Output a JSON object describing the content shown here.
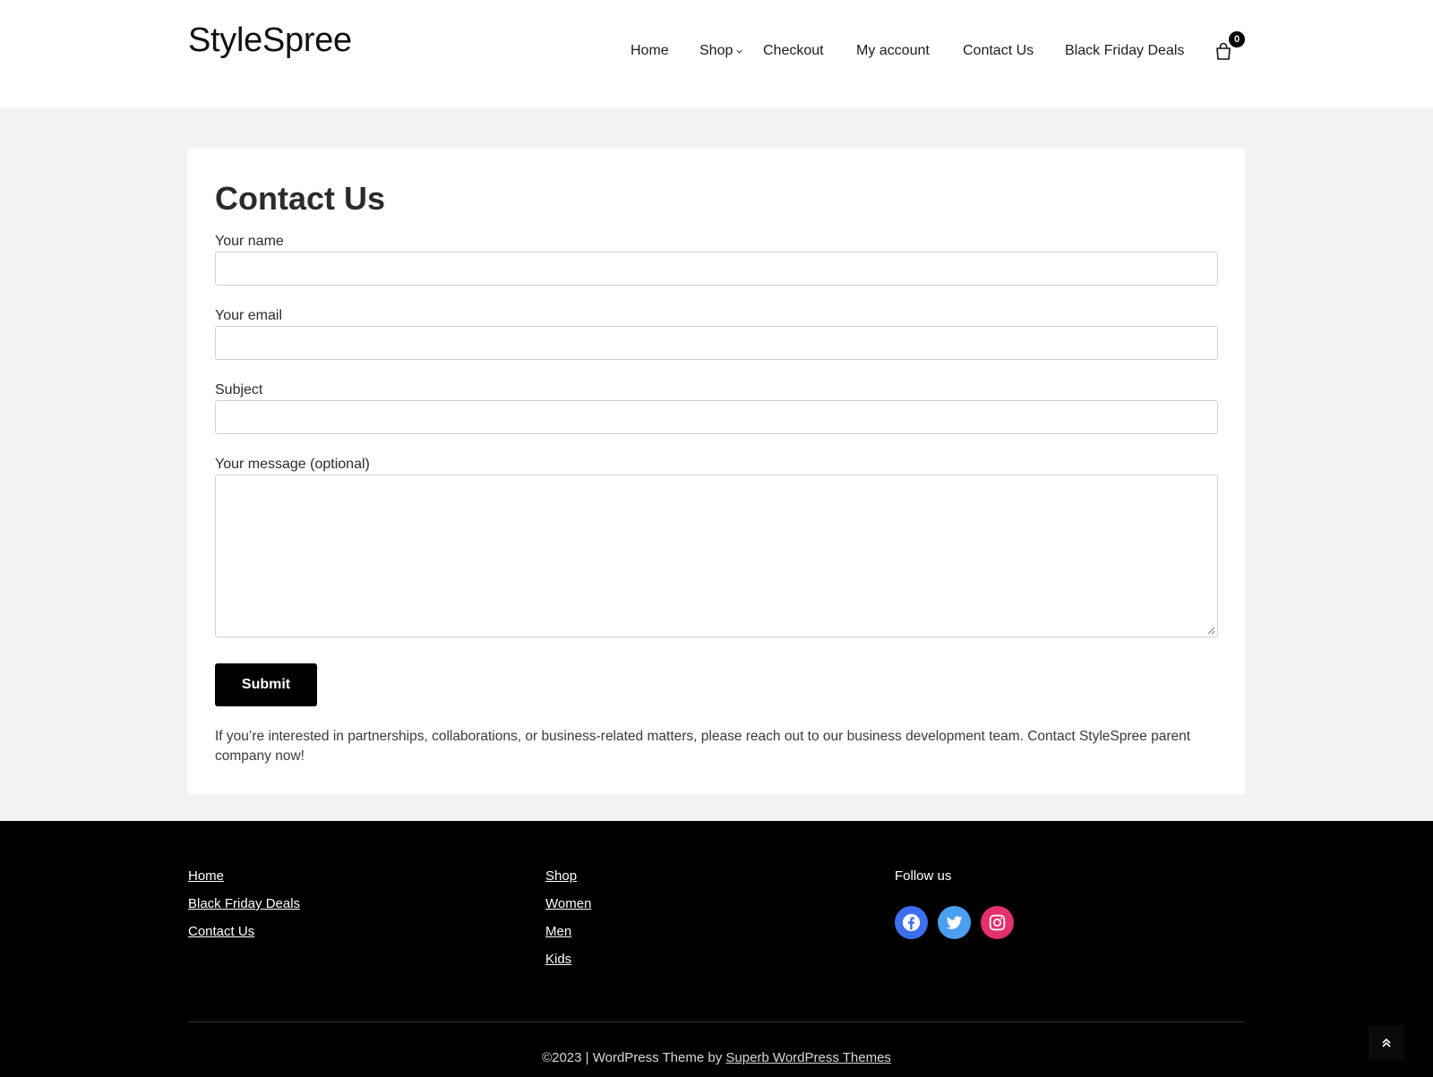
{
  "header": {
    "logo": "StyleSpree",
    "nav": [
      {
        "label": "Home"
      },
      {
        "label": "Shop",
        "has_dropdown": true
      },
      {
        "label": "Checkout"
      },
      {
        "label": "My account"
      },
      {
        "label": "Contact Us"
      },
      {
        "label": "Black Friday Deals"
      }
    ],
    "cart_count": "0",
    "cart_icon": "shopping-bag-icon"
  },
  "main": {
    "title": "Contact Us",
    "form": {
      "name_label": "Your name",
      "name_value": "",
      "email_label": "Your email",
      "email_value": "",
      "subject_label": "Subject",
      "subject_value": "",
      "message_label": "Your message (optional)",
      "message_value": "",
      "submit_label": "Submit"
    },
    "note": "If you’re interested in partnerships, collaborations, or business-related matters, please reach out to our business development team. Contact StyleSpree parent company now!"
  },
  "footer": {
    "col1": [
      "Home",
      "Black Friday Deals",
      "Contact Us"
    ],
    "col2": [
      "Shop",
      "Women",
      "Men",
      "Kids"
    ],
    "follow_title": "Follow us",
    "social": [
      {
        "icon": "facebook-icon",
        "color": "#3b6ff0"
      },
      {
        "icon": "twitter-icon",
        "color": "#4a9ff0"
      },
      {
        "icon": "instagram-icon",
        "color": "#e4306c"
      }
    ],
    "copyright_prefix": "©2023 | WordPress Theme by ",
    "copyright_link": "Superb WordPress Themes",
    "back_to_top_icon": "double-chevron-up-icon"
  }
}
